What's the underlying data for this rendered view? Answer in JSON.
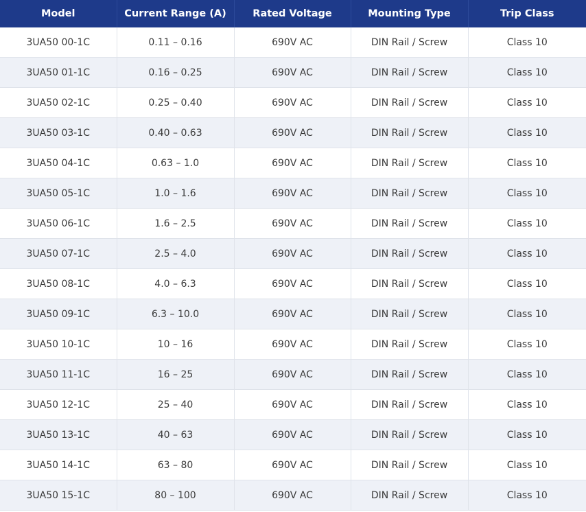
{
  "table": {
    "headers": [
      "Model",
      "Current Range (A)",
      "Rated Voltage",
      "Mounting Type",
      "Trip Class"
    ],
    "rows": [
      [
        "3UA50 00-1C",
        "0.11 – 0.16",
        "690V AC",
        "DIN Rail / Screw",
        "Class 10"
      ],
      [
        "3UA50 01-1C",
        "0.16 – 0.25",
        "690V AC",
        "DIN Rail / Screw",
        "Class 10"
      ],
      [
        "3UA50 02-1C",
        "0.25 – 0.40",
        "690V AC",
        "DIN Rail / Screw",
        "Class 10"
      ],
      [
        "3UA50 03-1C",
        "0.40 – 0.63",
        "690V AC",
        "DIN Rail / Screw",
        "Class 10"
      ],
      [
        "3UA50 04-1C",
        "0.63 – 1.0",
        "690V AC",
        "DIN Rail / Screw",
        "Class 10"
      ],
      [
        "3UA50 05-1C",
        "1.0 – 1.6",
        "690V AC",
        "DIN Rail / Screw",
        "Class 10"
      ],
      [
        "3UA50 06-1C",
        "1.6 – 2.5",
        "690V AC",
        "DIN Rail / Screw",
        "Class 10"
      ],
      [
        "3UA50 07-1C",
        "2.5 – 4.0",
        "690V AC",
        "DIN Rail / Screw",
        "Class 10"
      ],
      [
        "3UA50 08-1C",
        "4.0 – 6.3",
        "690V AC",
        "DIN Rail / Screw",
        "Class 10"
      ],
      [
        "3UA50 09-1C",
        "6.3 – 10.0",
        "690V AC",
        "DIN Rail / Screw",
        "Class 10"
      ],
      [
        "3UA50 10-1C",
        "10 – 16",
        "690V AC",
        "DIN Rail / Screw",
        "Class 10"
      ],
      [
        "3UA50 11-1C",
        "16 – 25",
        "690V AC",
        "DIN Rail / Screw",
        "Class 10"
      ],
      [
        "3UA50 12-1C",
        "25 – 40",
        "690V AC",
        "DIN Rail / Screw",
        "Class 10"
      ],
      [
        "3UA50 13-1C",
        "40 – 63",
        "690V AC",
        "DIN Rail / Screw",
        "Class 10"
      ],
      [
        "3UA50 14-1C",
        "63 – 80",
        "690V AC",
        "DIN Rail / Screw",
        "Class 10"
      ],
      [
        "3UA50 15-1C",
        "80 – 100",
        "690V AC",
        "DIN Rail / Screw",
        "Class 10"
      ]
    ]
  },
  "colors": {
    "header_bg": "#1e3a8a",
    "header_text": "#ffffff",
    "row_alt_bg": "#eef1f7",
    "cell_text": "#3a3a3a"
  }
}
